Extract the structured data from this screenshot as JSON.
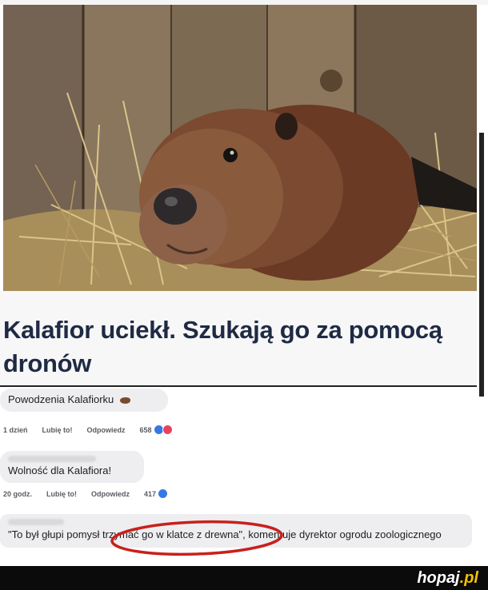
{
  "headline": "Kalafior uciekł. Szukają go za pomocą dronów",
  "comments": [
    {
      "text": "Powodzenia Kalafiorku",
      "time": "1 dzień",
      "like_label": "Lubię to!",
      "reply_label": "Odpowiedz",
      "reactions": "658"
    },
    {
      "text": "Wolność dla Kalafiora!",
      "time": "20 godz.",
      "like_label": "Lubię to!",
      "reply_label": "Odpowiedz",
      "reactions": "417"
    },
    {
      "text": "\"To był głupi pomysł trzymać go w klatce z drewna\", komentuje dyrektor ogrodu zoologicznego"
    }
  ],
  "brand": {
    "name": "hopaj",
    "tld": ".pl"
  },
  "colors": {
    "headline": "#1f2a44",
    "highlight_oval": "#c8201c",
    "like": "#3578e5",
    "love": "#e8425f"
  }
}
